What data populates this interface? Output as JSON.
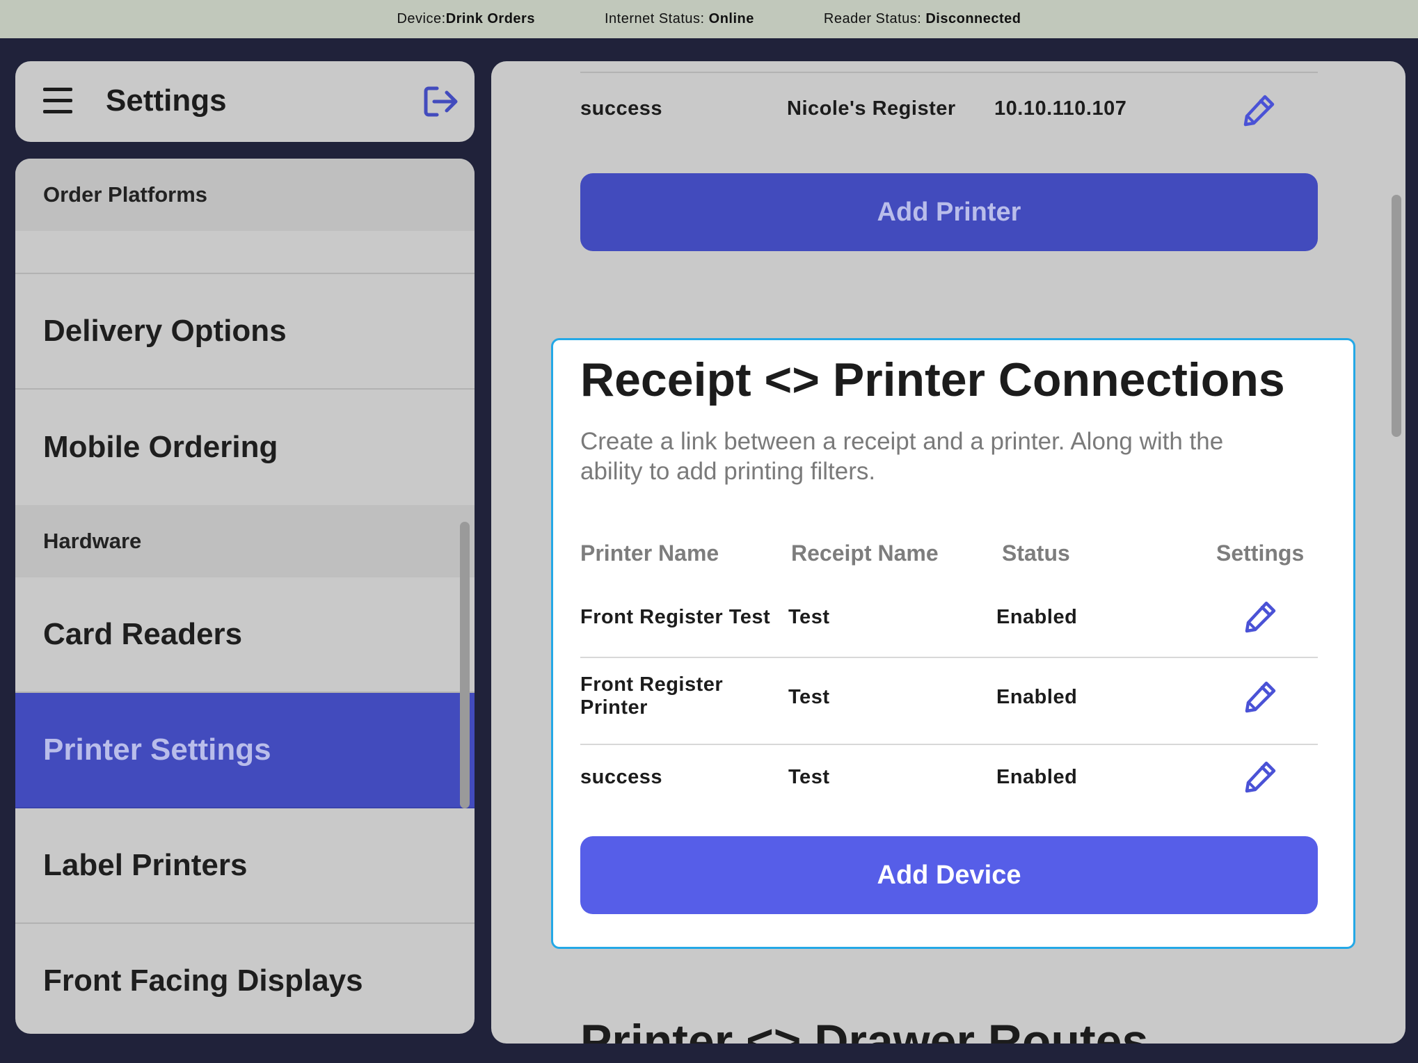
{
  "status_bar": {
    "device_label": "Device:",
    "device_value": "Drink Orders",
    "internet_label": "Internet Status: ",
    "internet_value": "Online",
    "reader_label": "Reader Status: ",
    "reader_value": "Disconnected"
  },
  "sidebar": {
    "title": "Settings",
    "menu_icon": "hamburger-menu-icon",
    "logout_icon": "logout-icon",
    "sections": {
      "order_platforms": "Order Platforms",
      "hardware": "Hardware"
    },
    "items": {
      "delivery_options": "Delivery Options",
      "mobile_ordering": "Mobile Ordering",
      "card_readers": "Card Readers",
      "printer_settings": "Printer Settings",
      "label_printers": "Label Printers",
      "front_facing_displays": "Front Facing Displays"
    },
    "active_item": "Printer Settings"
  },
  "printers": {
    "row": {
      "name": "success",
      "register": "Nicole's Register",
      "ip": "10.10.110.107",
      "edit_icon": "pencil-icon"
    },
    "add_button": "Add Printer"
  },
  "connections": {
    "title": "Receipt <> Printer Connections",
    "description": "Create a link between a receipt and a printer. Along with the ability to add printing filters.",
    "headers": {
      "printer_name": "Printer Name",
      "receipt_name": "Receipt Name",
      "status": "Status",
      "settings": "Settings"
    },
    "rows": [
      {
        "printer": "Front Register Test",
        "receipt": "Test",
        "status": "Enabled",
        "icon": "pencil-icon"
      },
      {
        "printer": "Front Register Printer",
        "receipt": "Test",
        "status": "Enabled",
        "icon": "pencil-icon"
      },
      {
        "printer": "success",
        "receipt": "Test",
        "status": "Enabled",
        "icon": "pencil-icon"
      }
    ],
    "add_button": "Add Device"
  },
  "next_section_title": "Printer <> Drawer Routes",
  "colors": {
    "accent": "#424bbd",
    "accent_bright": "#565ee8",
    "card_border": "#24a8e6",
    "background": "#20223a",
    "status_bar": "#c1c8bb"
  }
}
